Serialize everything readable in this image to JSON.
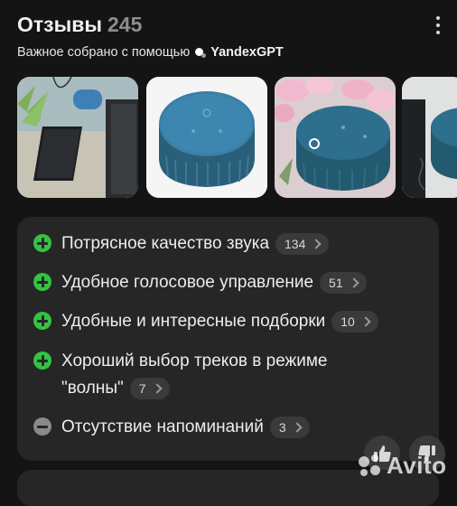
{
  "header": {
    "title": "Отзывы",
    "count": "245",
    "subtitle_prefix": "Важное собрано с помощью",
    "gpt_name": "YandexGPT"
  },
  "photos": [
    {
      "icon": "review-photo-speaker-and-phone"
    },
    {
      "icon": "review-photo-blue-speaker"
    },
    {
      "icon": "review-photo-speaker-with-flowers"
    },
    {
      "icon": "review-photo-speaker-partial"
    }
  ],
  "features": [
    {
      "type": "pro",
      "text": "Потрясное качество звука",
      "count": "134"
    },
    {
      "type": "pro",
      "text": "Удобное голосовое управление",
      "count": "51"
    },
    {
      "type": "pro",
      "text": "Удобные и интересные подборки",
      "count": "10"
    },
    {
      "type": "pro",
      "text_line1": "Хороший выбор треков в режиме",
      "text_line2": "\"волны\"",
      "count": "7"
    },
    {
      "type": "con",
      "text": "Отсутствие напоминаний",
      "count": "3"
    }
  ],
  "watermark": "Avito",
  "colors": {
    "background": "#141414",
    "card": "#262626",
    "pro_green": "#33c343",
    "con_gray": "#8a8a8a",
    "pill": "#3a3a3a"
  }
}
